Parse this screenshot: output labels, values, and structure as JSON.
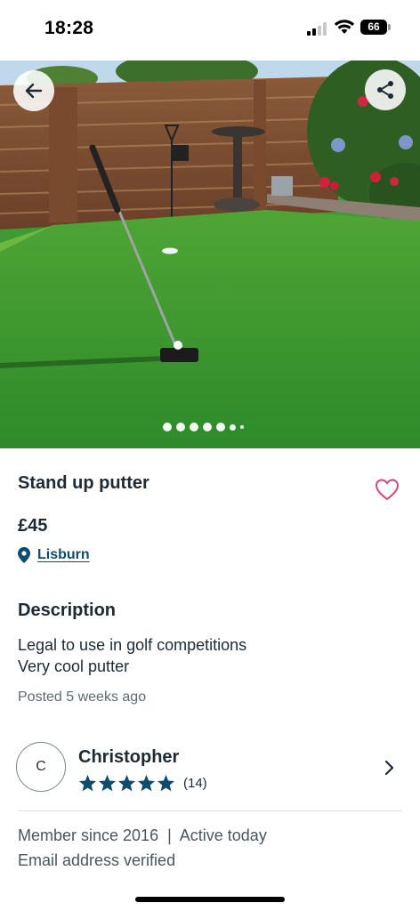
{
  "status": {
    "time": "18:28",
    "battery": "66"
  },
  "listing": {
    "title": "Stand up putter",
    "price": "£45",
    "location": "Lisburn",
    "description_heading": "Description",
    "description_lines": [
      "Legal to use in golf competitions",
      "Very cool putter"
    ],
    "posted": "Posted 5 weeks ago"
  },
  "gallery": {
    "image_count": 7,
    "active_index": 0
  },
  "seller": {
    "initial": "C",
    "name": "Christopher",
    "rating_stars": 5,
    "review_count": "(14)",
    "member_info": "Member since 2016  |  Active today",
    "verification": "Email address verified"
  },
  "icons": {
    "back": "arrow-left-icon",
    "share": "share-icon",
    "favorite": "heart-outline-icon",
    "location": "map-pin-icon",
    "chevron": "chevron-right-icon",
    "star": "star-icon"
  },
  "colors": {
    "accent": "#0f4c6b",
    "favorite": "#d6457b",
    "star": "#0f4c6b"
  }
}
